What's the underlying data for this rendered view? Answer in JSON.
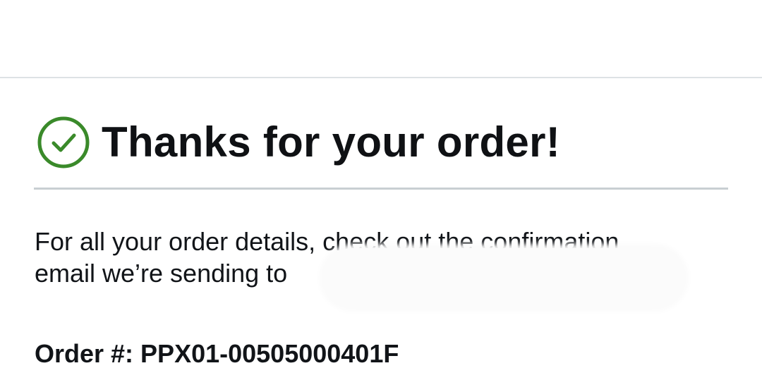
{
  "confirmation": {
    "title": "Thanks for your order!",
    "icon": "check-circle-icon",
    "icon_color": "#3a8a2a"
  },
  "details": {
    "message_line1": "For all your order details, check out the confirmation",
    "message_line2": "email we’re sending to "
  },
  "order": {
    "number_label": "Order #: PPX01-00505000401F"
  },
  "colors": {
    "text": "#111418",
    "divider": "#c8cfd2",
    "header_divider": "#dde2e5",
    "success": "#3a8a2a"
  }
}
